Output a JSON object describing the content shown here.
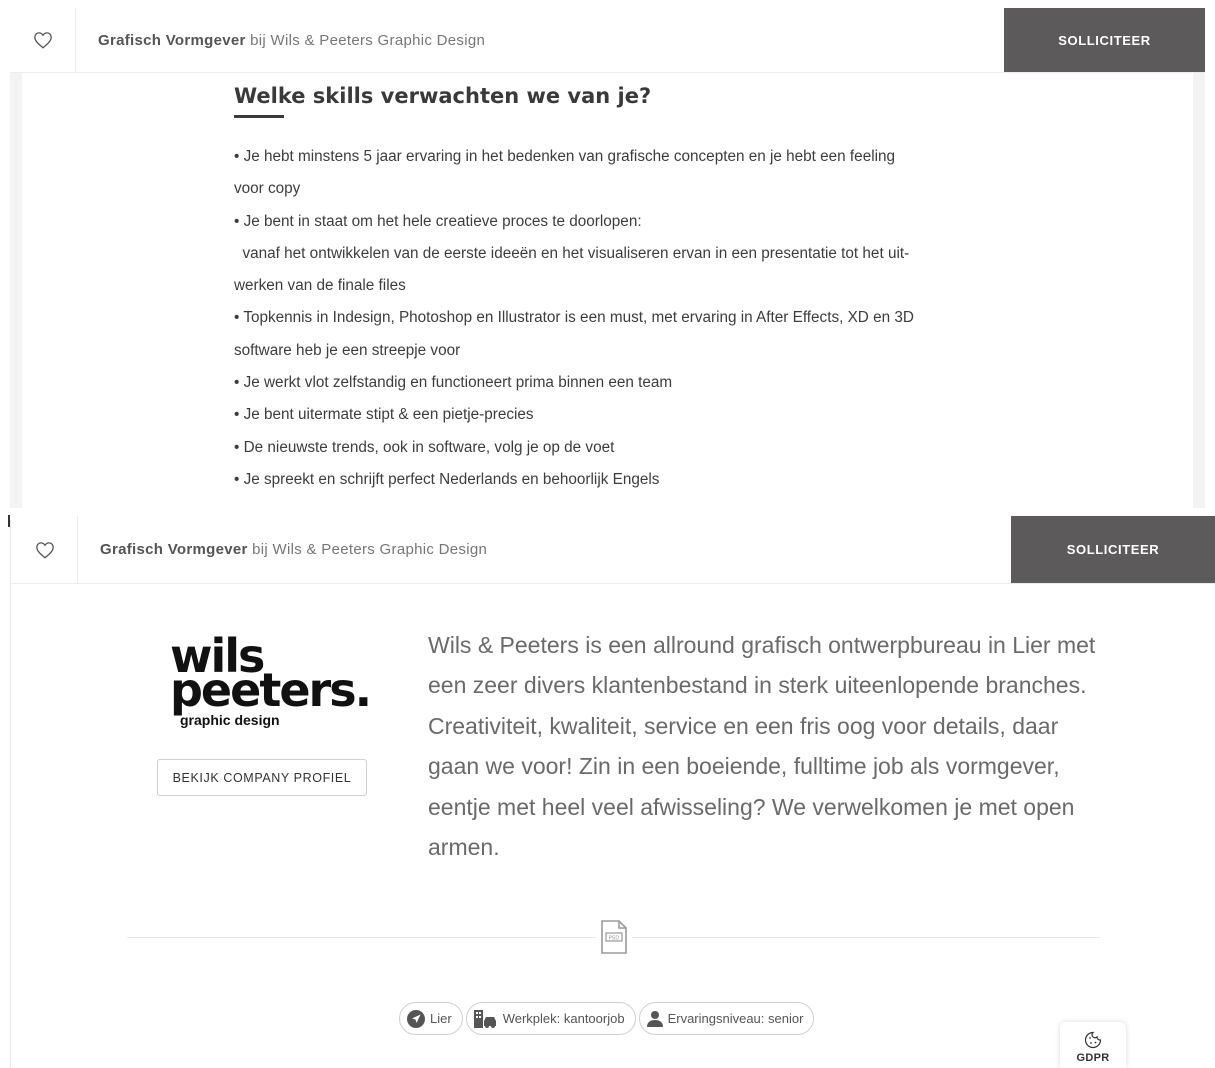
{
  "top_job_bar": {
    "title": "Grafisch Vormgever",
    "connector": " bij ",
    "company": "Wils & Peeters Graphic Design",
    "apply_label": "SOLLICITEER"
  },
  "skills": {
    "heading": "Welke skills verwachten we van je?",
    "lines": [
      "• Je hebt minstens 5 jaar ervaring in het bedenken van grafische concepten en je hebt een feeling",
      "voor copy",
      "• Je bent in staat om het hele creatieve proces te doorlopen:",
      "  vanaf het ontwikkelen van de eerste ideeën en het visualiseren ervan in een presentatie tot het uit-",
      "werken van de finale files",
      "• Topkennis in Indesign, Photoshop en Illustrator is een must, met ervaring in After Effects, XD en 3D",
      "software heb je een streepje voor",
      "• Je werkt vlot zelfstandig en functioneert prima binnen een team",
      "• Je bent uitermate stipt & een pietje-precies",
      "• De nieuwste trends, ook in software, volg je op de voet",
      "• Je spreekt en schrijft perfect Nederlands en behoorlijk Engels"
    ]
  },
  "bottom_job_bar": {
    "title": "Grafisch Vormgever",
    "connector": " bij ",
    "company": "Wils & Peeters Graphic Design",
    "apply_label": "SOLLICITEER"
  },
  "company": {
    "logo_line1": "wils",
    "logo_line2": "peeters.",
    "logo_line3": "graphic design",
    "profile_button": "BEKIJK COMPANY PROFIEL",
    "about": "Wils & Peeters is een allround grafisch ontwerpbureau in Lier met een zeer divers klantenbestand in sterk uiteenlopende branches. Creativiteit, kwaliteit, service en een fris oog voor details, daar gaan we voor! Zin in een boeiende, fulltime job als vormgever, eentje met heel veel afwisseling? We verwelkomen je met open armen."
  },
  "tags": [
    {
      "icon": "location-arrow-icon",
      "label": "Lier"
    },
    {
      "icon": "building-car-icon",
      "label": "Werkplek: kantoorjob"
    },
    {
      "icon": "user-icon",
      "label": "Ervaringsniveau: senior"
    }
  ],
  "gdpr": {
    "icon": "cookie-icon",
    "label": "GDPR"
  },
  "colors": {
    "apply_bg": "#5c5a5a",
    "text_dark": "#3a3a3a",
    "panel_bg": "#f3f3f3"
  }
}
